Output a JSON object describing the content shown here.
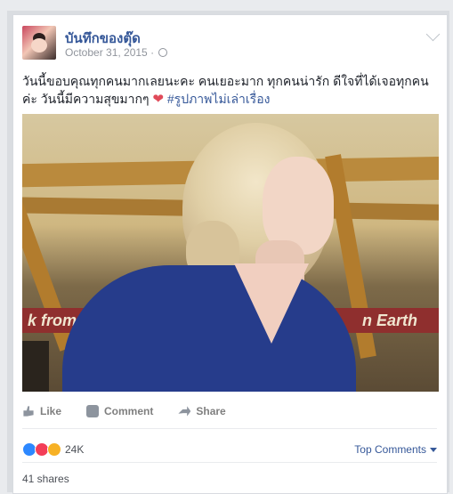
{
  "post": {
    "author": "บันทึกของตุ๊ด",
    "date": "October 31, 2015 ·",
    "caption_text": "วันนี้ขอบคุณทุกคนมากเลยนะคะ คนเยอะมาก ทุกคนน่ารัก ดีใจที่ได้เจอทุกคนค่ะ วันนี้มีความสุขมากๆ",
    "caption_hashtag": "#รูปภาพไม่เล่าเรื่อง",
    "photo_banner_left": "k from Par",
    "photo_banner_right": "n Earth"
  },
  "actions": {
    "like": "Like",
    "comment": "Comment",
    "share": "Share"
  },
  "reactions": {
    "count": "24K",
    "top_comments": "Top Comments"
  },
  "shares": "41 shares",
  "icons": [
    "globe-icon",
    "chevron-down-icon",
    "like-icon",
    "comment-icon",
    "share-icon",
    "reaction-like-icon",
    "reaction-love-icon",
    "reaction-wow-icon"
  ]
}
